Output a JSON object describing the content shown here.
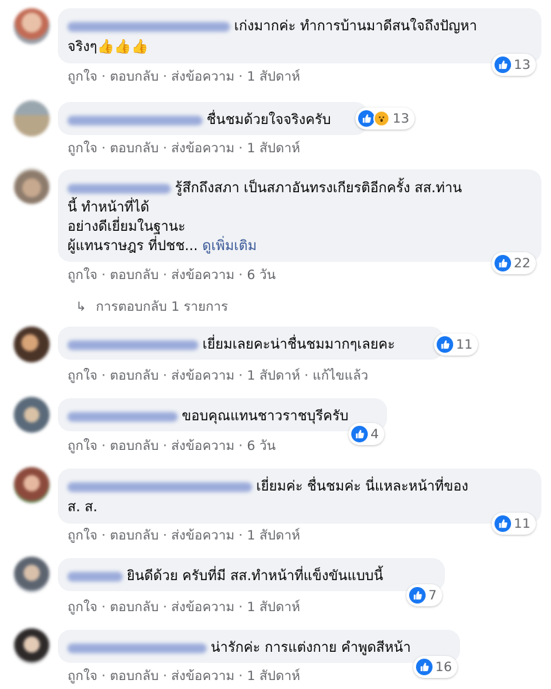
{
  "actions": {
    "like": "ถูกใจ",
    "reply": "ตอบกลับ",
    "message": "ส่งข้อความ",
    "sep": "·"
  },
  "replies_link": "การตอบกลับ 1 รายการ",
  "comments": [
    {
      "text": "เก่งมากค่ะ ทำการบ้านมาดีสนใจถึงปัญหา",
      "text2": "จริงๆ👍👍👍",
      "reactions": "13",
      "time": "1 สัปดาห์"
    },
    {
      "text": "ชื่นชมด้วยใจจริงครับ",
      "reactions": "13",
      "time": "1 สัปดาห์"
    },
    {
      "text": "รู้สึกถึงสภา เป็นสภาอันทรงเกียรติอีกครั้ง สส.ท่าน",
      "text2": "นี้ ทำหน้าที่ได้",
      "text3": "อย่างดีเยี่ยมในฐานะ",
      "text4": "ผู้แทนราษฎร ที่ปชช...",
      "see_more": "ดูเพิ่มเติม",
      "reactions": "22",
      "time": "6 วัน"
    },
    {
      "text": "เยี่ยมเลยคะน่าชื่นชมมากๆเลยคะ",
      "reactions": "11",
      "time": "1 สัปดาห์",
      "edited": "แก้ไขแล้ว"
    },
    {
      "text": "ขอบคุณแทนชาวราชบุรีครับ",
      "reactions": "4",
      "time": "6 วัน"
    },
    {
      "text": "เยี่ยมค่ะ ชื่นชมค่ะ นี่แหละหน้าที่ของ",
      "text2": "ส. ส.",
      "reactions": "11",
      "time": "1 สัปดาห์"
    },
    {
      "text": "ยินดีด้วย ครับที่มี สส.ทำหน้าที่แข็งขันแบบนี้",
      "reactions": "7",
      "time": "1 สัปดาห์"
    },
    {
      "text": "น่ารักค่ะ การแต่งกาย คำพูดสีหน้า",
      "reactions": "16",
      "time": "1 สัปดาห์"
    }
  ],
  "colors": {
    "like": "#1877f2",
    "bubble": "#f0f2f5",
    "meta": "#65676b"
  }
}
